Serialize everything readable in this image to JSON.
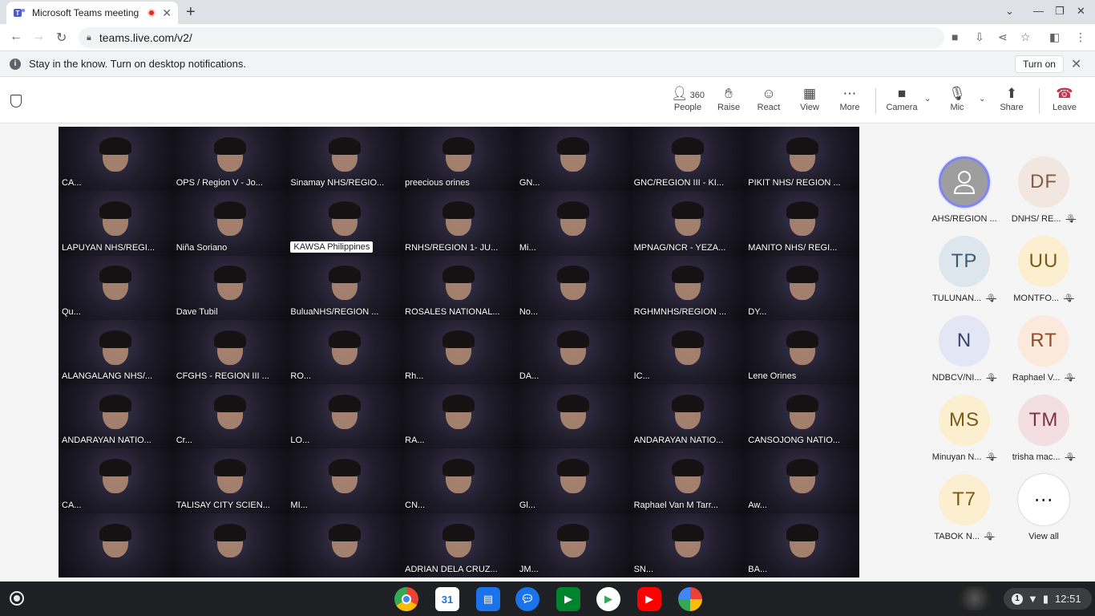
{
  "browser": {
    "tab_title": "Microsoft Teams meeting | M",
    "url": "teams.live.com/v2/"
  },
  "infobar": {
    "message": "Stay in the know. Turn on desktop notifications.",
    "turn_on_label": "Turn on"
  },
  "toolbar": {
    "people_label": "People",
    "people_count": "360",
    "raise_label": "Raise",
    "react_label": "React",
    "view_label": "View",
    "more_label": "More",
    "camera_label": "Camera",
    "mic_label": "Mic",
    "share_label": "Share",
    "leave_label": "Leave"
  },
  "gallery": [
    "CA...",
    "OPS / Region V - Jo...",
    "Sinamay NHS/REGIO...",
    "preecious orines",
    "GN...",
    "GNC/REGION III - KI...",
    "PIKIT NHS/ REGION ...",
    "LAPUYAN NHS/REGI...",
    "Niña Soriano",
    "KAWSA Philippines",
    "RNHS/REGION 1- JU...",
    "Mi...",
    "MPNAG/NCR - YEZA...",
    "MANITO NHS/ REGI...",
    "Qu...",
    "Dave Tubil",
    "BuluaNHS/REGION ...",
    "ROSALES NATIONAL...",
    "No...",
    "RGHMNHS/REGION ...",
    "DY...",
    "ALANGALANG NHS/...",
    "CFGHS - REGION III ...",
    "RO...",
    "Rh...",
    "DA...",
    "IC...",
    "Lene Orines",
    "ANDARAYAN NATIO...",
    "Cr...",
    "LO...",
    "RA...",
    "",
    "ANDARAYAN NATIO...",
    "CANSOJONG NATIO...",
    "CA...",
    "TALISAY CITY SCIEN...",
    "MI...",
    "CN...",
    "Gl...",
    "Raphael Van M Tarr...",
    "Aw...",
    "",
    "",
    "",
    "ADRIAN DELA CRUZ...",
    "JM...",
    "SN...",
    "BA..."
  ],
  "participants": [
    {
      "initials": "",
      "name": "AHS/REGION ...",
      "muted": false,
      "bg": "#9e9e9e",
      "fg": "#ffffff"
    },
    {
      "initials": "DF",
      "name": "DNHS/ RE...",
      "muted": true,
      "bg": "#f2e6e1",
      "fg": "#8a5a44"
    },
    {
      "initials": "TP",
      "name": "TULUNAN...",
      "muted": true,
      "bg": "#dde6ec",
      "fg": "#3f5a6b"
    },
    {
      "initials": "UU",
      "name": "MONTFO...",
      "muted": true,
      "bg": "#fbefd0",
      "fg": "#7a5a16"
    },
    {
      "initials": "N",
      "name": "NDBCV/NI...",
      "muted": true,
      "bg": "#e3e6f4",
      "fg": "#3a4273"
    },
    {
      "initials": "RT",
      "name": "Raphael V...",
      "muted": true,
      "bg": "#fbe9dc",
      "fg": "#8f4b24"
    },
    {
      "initials": "MS",
      "name": "Minuyan N...",
      "muted": true,
      "bg": "#fbefd0",
      "fg": "#7a5a16"
    },
    {
      "initials": "TM",
      "name": "trisha mac...",
      "muted": true,
      "bg": "#f3dfe2",
      "fg": "#7a3340"
    },
    {
      "initials": "T7",
      "name": "TABOK N...",
      "muted": true,
      "bg": "#fbefd0",
      "fg": "#7a5a16"
    },
    {
      "initials": "⋯",
      "name": "View all",
      "muted": false,
      "bg": "#ffffff",
      "fg": "#242424"
    }
  ],
  "shelf": {
    "time": "12:51",
    "notification_count": "1"
  }
}
